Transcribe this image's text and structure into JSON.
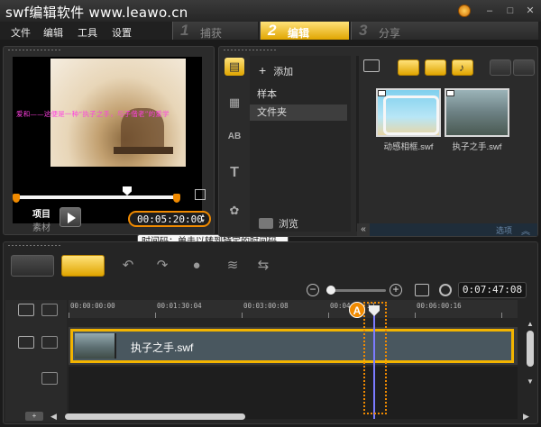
{
  "app": {
    "title": "swf编辑软件 www.leawo.cn",
    "window_buttons": {
      "minimize": "–",
      "maximize": "□",
      "close": "✕"
    }
  },
  "menu": [
    "文件",
    "编辑",
    "工具",
    "设置"
  ],
  "steps": [
    {
      "num": "1",
      "label": "捕获",
      "active": false
    },
    {
      "num": "2",
      "label": "编辑",
      "active": true
    },
    {
      "num": "3",
      "label": "分享",
      "active": false
    }
  ],
  "preview": {
    "subtitle": "爱和——这便是一种“执子之手，与子偕老”的爱学",
    "mode_label": "项目",
    "mode_sub": "素材",
    "timecode": "00:05:20:00",
    "tooltip": "时间码：单击以转到特定的时间码"
  },
  "library": {
    "add_label": "添加",
    "folders": [
      {
        "label": "样本",
        "selected": false
      },
      {
        "label": "文件夹",
        "selected": true
      }
    ],
    "browse_label": "浏览",
    "tab_icons": [
      "media-icon",
      "film-transition-icon",
      "ab-title-icon",
      "text-icon",
      "filter-icon"
    ],
    "tab_glyphs": [
      "▤",
      "▦",
      "AB",
      "T",
      "✿"
    ],
    "items": [
      {
        "caption": "动感相框.swf"
      },
      {
        "caption": "执子之手.swf"
      }
    ],
    "options_label": "选项"
  },
  "timeline": {
    "duration": "0:07:47:08",
    "ruler_labels": [
      "00:00:00:00",
      "00:01:30:04",
      "00:03:00:08",
      "00:04:30:12",
      "00:06:00:16"
    ],
    "clip_name": "执子之手.swf",
    "annotation": "A",
    "accent": "#f08a00"
  }
}
